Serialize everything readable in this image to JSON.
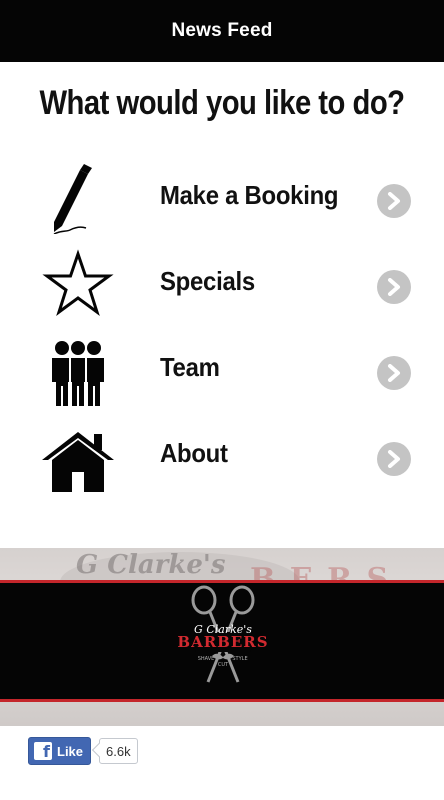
{
  "header": {
    "title": "News Feed"
  },
  "main": {
    "headline": "What would you like to do?",
    "menu": [
      {
        "label": "Make a Booking",
        "icon": "pen-icon"
      },
      {
        "label": "Specials",
        "icon": "star-icon"
      },
      {
        "label": "Team",
        "icon": "team-icon"
      },
      {
        "label": "About",
        "icon": "home-icon"
      }
    ]
  },
  "banner": {
    "logo_script": "G Clarke's",
    "logo_name": "BARBERS",
    "logo_tags": [
      "SHAVE",
      "CUT",
      "STYLE"
    ],
    "bg_script": "G Clarke's",
    "bg_letters": "B E R S"
  },
  "facebook": {
    "like_label": "Like",
    "count": "6.6k"
  },
  "colors": {
    "topbar": "#050505",
    "accent_red": "#c4262b",
    "chevron": "#c4c4c4",
    "fb_blue": "#4267b2"
  }
}
